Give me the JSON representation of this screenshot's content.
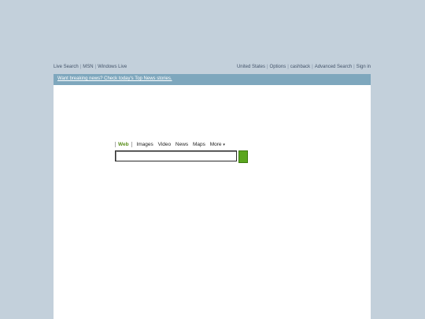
{
  "topnav": {
    "left_links": [
      "Live Search",
      "MSN",
      "Windows Live"
    ],
    "right_links": [
      "United States",
      "Options",
      "cashback",
      "Advanced Search",
      "Sign in"
    ],
    "separator": "|"
  },
  "banner": {
    "text": "Want breaking news? Check today's Top News stories.",
    "background": "#7ea7bd"
  },
  "search": {
    "scopes": [
      "Web",
      "Images",
      "Video",
      "News",
      "Maps",
      "More"
    ],
    "active_scope": "Web",
    "more_arrow": "▾",
    "input_value": "",
    "go_button_color": "#5aa61e",
    "go_icon": "search-go-icon"
  },
  "colors": {
    "page_bg": "#c3d0db",
    "content_bg": "#ffffff",
    "active_scope": "#5a8f1c"
  }
}
